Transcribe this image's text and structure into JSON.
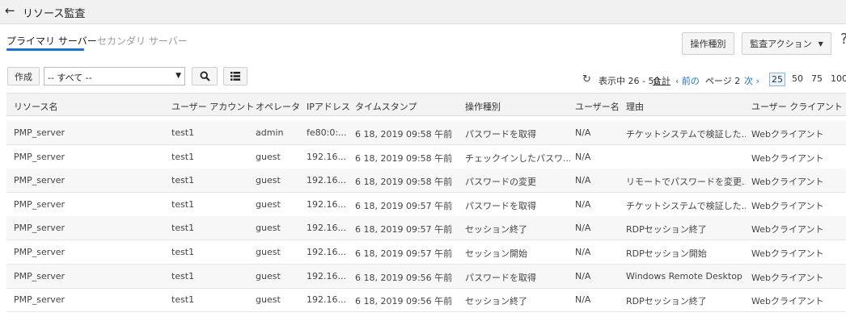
{
  "header": {
    "back_icon": "back-arrow-icon",
    "title": "リソース監査"
  },
  "tabs": [
    {
      "label": "プライマリ サーバー",
      "active": true
    },
    {
      "label": "セカンダリ サーバー",
      "active": false
    }
  ],
  "actions": {
    "optype_label": "操作種別",
    "audit_label": "監査アクション"
  },
  "toolbar": {
    "create_label": "作成",
    "filter_value": "-- すべて --",
    "search_icon": "search-icon",
    "list_icon": "list-view-icon"
  },
  "pagination": {
    "display": "表示中 26 - 50",
    "total_label": "合計",
    "prev": "‹ 前の",
    "page": "ページ 2",
    "next": "次 ›",
    "sizes": [
      "25",
      "50",
      "75",
      "100"
    ],
    "active_size": "25"
  },
  "table": {
    "columns": [
      "リソース名",
      "ユーザー アカウント",
      "オペレータ",
      "IPアドレス",
      "タイムスタンプ",
      "操作種別",
      "ユーザー名",
      "理由",
      "ユーザー クライアント"
    ],
    "rows": [
      [
        "PMP_server",
        "test1",
        "admin",
        "fe80:0:...",
        "6 18, 2019 09:58 午前",
        "パスワードを取得",
        "N/A",
        "チケットシステムで検証した...",
        "Webクライアント"
      ],
      [
        "PMP_server",
        "test1",
        "guest",
        "192.16...",
        "6 18, 2019 09:58 午前",
        "チェックインしたパスワ...",
        "N/A",
        "",
        "Webクライアント"
      ],
      [
        "PMP_server",
        "test1",
        "guest",
        "192.16...",
        "6 18, 2019 09:58 午前",
        "パスワードの変更",
        "N/A",
        "リモートでパスワードを変更...",
        "Webクライアント"
      ],
      [
        "PMP_server",
        "test1",
        "guest",
        "192.16...",
        "6 18, 2019 09:57 午前",
        "パスワードを取得",
        "N/A",
        "チケットシステムで検証した...",
        "Webクライアント"
      ],
      [
        "PMP_server",
        "test1",
        "guest",
        "192.16...",
        "6 18, 2019 09:57 午前",
        "セッション終了",
        "N/A",
        "RDPセッション終了",
        "Webクライアント"
      ],
      [
        "PMP_server",
        "test1",
        "guest",
        "192.16...",
        "6 18, 2019 09:57 午前",
        "セッション開始",
        "N/A",
        "RDPセッション開始",
        "Webクライアント"
      ],
      [
        "PMP_server",
        "test1",
        "guest",
        "192.16...",
        "6 18, 2019 09:56 午前",
        "パスワードを取得",
        "N/A",
        "Windows Remote Desktop ...",
        "Webクライアント"
      ],
      [
        "PMP_server",
        "test1",
        "guest",
        "192.16...",
        "6 18, 2019 09:56 午前",
        "セッション終了",
        "N/A",
        "RDPセッション終了",
        "Webクライアント"
      ]
    ]
  }
}
